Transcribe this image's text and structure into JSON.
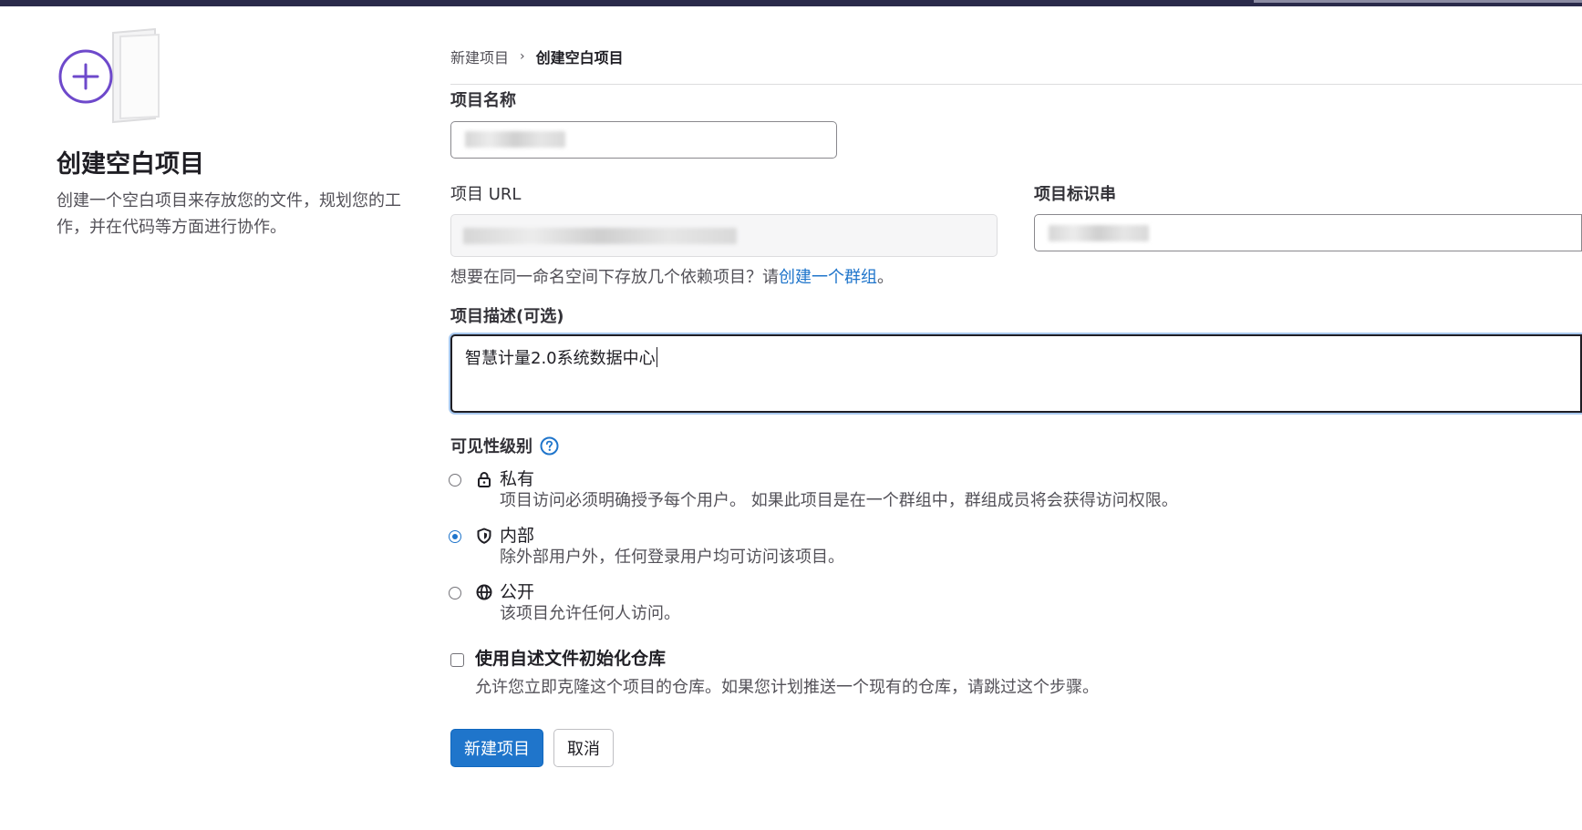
{
  "left": {
    "title": "创建空白项目",
    "description": "创建一个空白项目来存放您的文件，规划您的工作，并在代码等方面进行协作。"
  },
  "breadcrumb": {
    "parent": "新建项目",
    "separator": "›",
    "current": "创建空白项目"
  },
  "form": {
    "project_name": {
      "label": "项目名称",
      "value": ""
    },
    "project_url": {
      "label": "项目 URL",
      "value": ""
    },
    "project_slug": {
      "label": "项目标识串",
      "value": ""
    },
    "namespace_hint": {
      "text": "想要在同一命名空间下存放几个依赖项目？请",
      "link": "创建一个群组",
      "suffix": "。"
    },
    "description": {
      "label": "项目描述(可选)",
      "value": "智慧计量2.0系统数据中心"
    },
    "visibility": {
      "label": "可见性级别",
      "options": [
        {
          "title": "私有",
          "desc": "项目访问必须明确授予每个用户。 如果此项目是在一个群组中，群组成员将会获得访问权限。",
          "icon": "lock-icon",
          "checked": false
        },
        {
          "title": "内部",
          "desc": "除外部用户外，任何登录用户均可访问该项目。",
          "icon": "shield-icon",
          "checked": true
        },
        {
          "title": "公开",
          "desc": "该项目允许任何人访问。",
          "icon": "globe-icon",
          "checked": false
        }
      ]
    },
    "readme": {
      "title": "使用自述文件初始化仓库",
      "desc": "允许您立即克隆这个项目的仓库。如果您计划推送一个现有的仓库，请跳过这个步骤。",
      "checked": false
    }
  },
  "buttons": {
    "create": "新建项目",
    "cancel": "取消"
  },
  "colors": {
    "accent": "#1f75cb",
    "illustration": "#6e49cb"
  }
}
